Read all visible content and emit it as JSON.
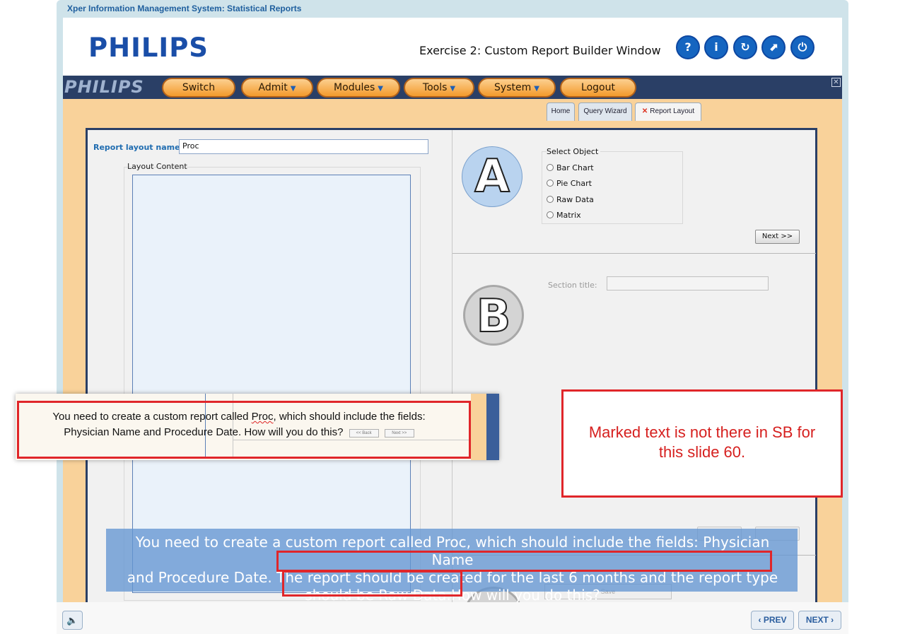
{
  "course": {
    "frame_title": "Xper Information Management System: Statistical Reports",
    "logo": "PHILIPS",
    "exercise_title": "Exercise 2: Custom Report Builder Window",
    "header_buttons": [
      {
        "icon": "help-icon",
        "glyph": "?"
      },
      {
        "icon": "info-icon",
        "glyph": "i"
      },
      {
        "icon": "replay-icon",
        "glyph": "↻"
      },
      {
        "icon": "compass-icon",
        "glyph": "⬈"
      },
      {
        "icon": "power-icon",
        "glyph": "⏻"
      }
    ]
  },
  "app": {
    "menubar_logo": "PHILIPS",
    "menu": {
      "switch": "Switch",
      "admit": "Admit",
      "modules": "Modules",
      "tools": "Tools",
      "system": "System",
      "logout": "Logout"
    },
    "tabs": {
      "home": "Home",
      "query_wizard": "Query Wizard",
      "report_layout": "Report Layout"
    },
    "report_layout_label": "Report layout name:",
    "report_layout_value": "Proc",
    "layout_content_label": "Layout Content",
    "select_object": {
      "title": "Select Object",
      "options": [
        "Bar Chart",
        "Pie Chart",
        "Raw Data",
        "Matrix"
      ]
    },
    "next_button": "Next >>",
    "section_title_label": "Section title:",
    "save_label": "Save",
    "badges": {
      "a": "A",
      "b": "B"
    }
  },
  "snippet": {
    "line1_pre": "You need to create a custom report called ",
    "line1_word": "Proc",
    "line1_post": ", which should include the fields:",
    "line2": "Physician Name and Procedure Date. How will you do this?",
    "back_btn": "<< Back",
    "next_btn": "Next >>"
  },
  "review_note": {
    "line1": "Marked text is not there in SB for",
    "line2": "this slide 60."
  },
  "caption": {
    "line1": "You need to create a custom report called Proc, which should include the fields: Physician Name",
    "line2": "and Procedure Date. The report should be created for the last 6 months and the report type",
    "line3": "should be Raw Data.How will you do this?"
  },
  "footer": {
    "prev": "PREV",
    "next": "NEXT"
  },
  "colors": {
    "brand_blue": "#1a4ea8",
    "menu_orange": "#f39a2c",
    "review_red": "#e0262a",
    "caption_blue": "#6496d2"
  }
}
